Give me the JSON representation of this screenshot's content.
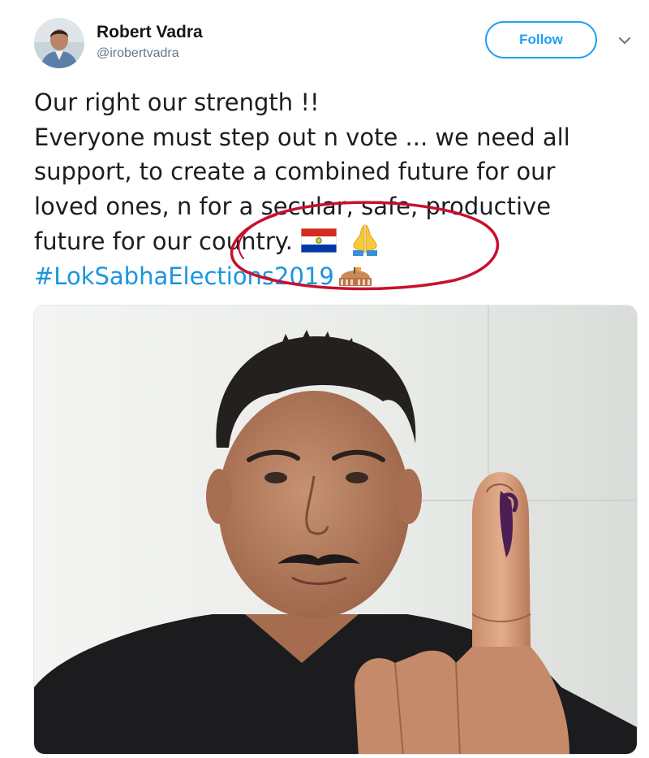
{
  "author": {
    "name": "Robert Vadra",
    "handle": "@irobertvadra",
    "avatar_icon": "user-avatar"
  },
  "follow_button": {
    "label": "Follow"
  },
  "menu": {
    "icon": "chevron-down-icon"
  },
  "tweet": {
    "line1": "Our right our strength !!",
    "line2": "Everyone must step out n vote ... we need all",
    "line3": "support, to create a combined future for our",
    "line4": "loved ones, n for a secular, safe, productive",
    "line5": "future for our country.",
    "hashtag": "#LokSabhaElections2019",
    "emojis": [
      "flag-icon",
      "folded-hands-icon",
      "parliament-icon"
    ]
  },
  "media": {
    "type": "photo",
    "subject": "selfie-with-inked-finger"
  },
  "colors": {
    "accent": "#1da1f2",
    "hashtag": "#1b95e0",
    "annotation": "#c8102e",
    "text": "#14171a",
    "secondary_text": "#657786"
  }
}
